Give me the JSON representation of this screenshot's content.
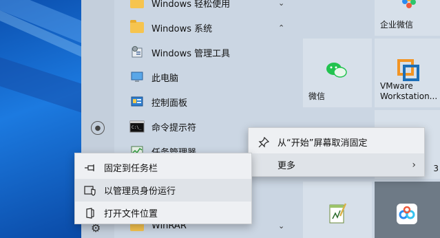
{
  "applist": [
    {
      "label": "Windows 轻松使用",
      "icon": "folder-icon",
      "chevron": "⌄"
    },
    {
      "label": "Windows 系统",
      "icon": "folder-icon",
      "chevron": "⌃"
    },
    {
      "label": "Windows 管理工具",
      "icon": "admin-tools-icon"
    },
    {
      "label": "此电脑",
      "icon": "computer-icon"
    },
    {
      "label": "控制面板",
      "icon": "control-panel-icon"
    },
    {
      "label": "命令提示符",
      "icon": "command-prompt-icon"
    },
    {
      "label": "任务管理器",
      "icon": "task-manager-icon"
    },
    {
      "label": "WinRAR",
      "icon": "folder-icon",
      "chevron": "⌄"
    }
  ],
  "tiles": {
    "wecom": "企业微信",
    "wechat": "微信",
    "vmware": "VMware Workstation...",
    "partial": "3"
  },
  "context_menu_right": {
    "items": [
      {
        "label": "从“开始”屏幕取消固定",
        "icon": "unpin-icon"
      },
      {
        "label": "更多",
        "icon": ""
      }
    ],
    "more_chevron": "›"
  },
  "context_menu_left": {
    "items": [
      {
        "label": "固定到任务栏",
        "icon": "pin-icon"
      },
      {
        "label": "以管理员身份运行",
        "icon": "shield-icon"
      },
      {
        "label": "打开文件位置",
        "icon": "open-file-location-icon"
      }
    ]
  }
}
